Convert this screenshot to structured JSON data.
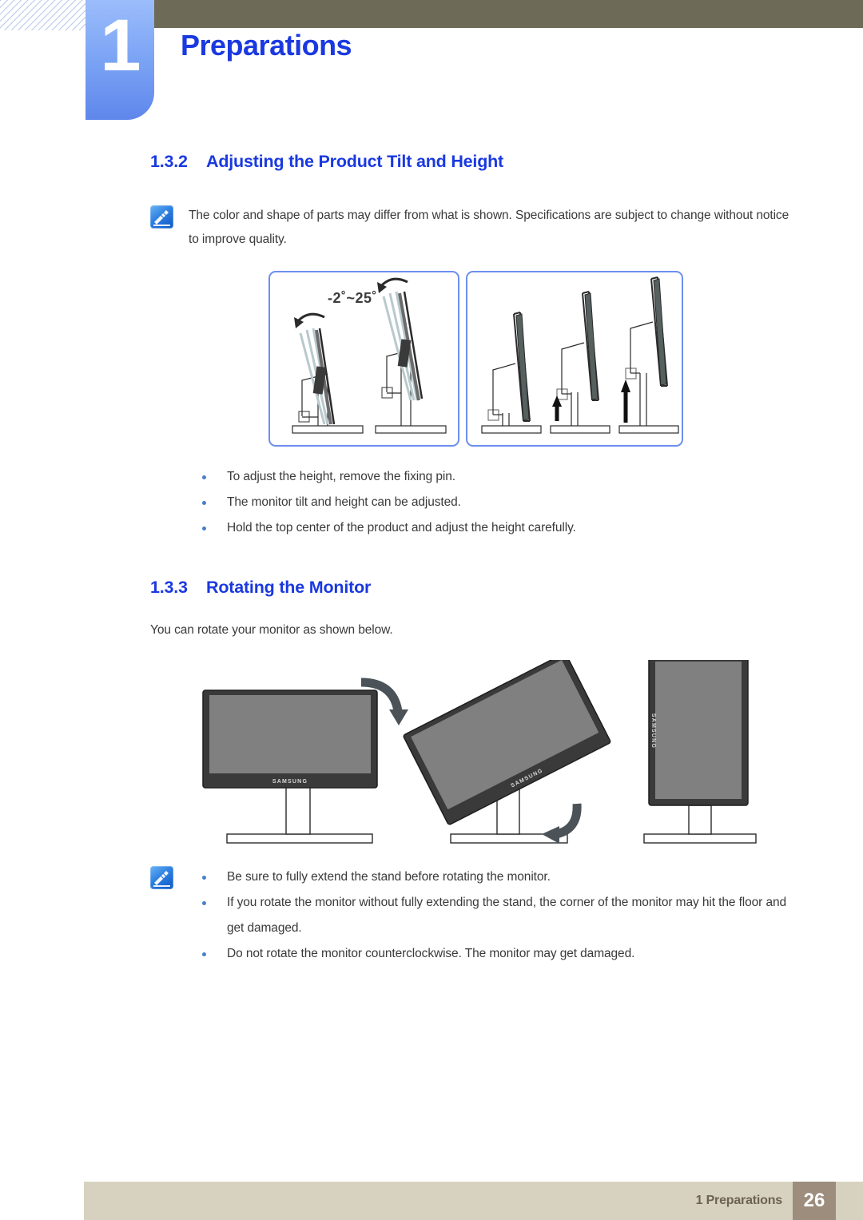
{
  "header": {
    "chapter_number": "1",
    "chapter_title": "Preparations",
    "tab_color": "#7ea6f5",
    "bar_color": "#6d6b57",
    "title_color": "#1a39e0"
  },
  "sections": [
    {
      "number": "1.3.2",
      "title": "Adjusting the Product Tilt and Height",
      "note": "The color and shape of parts may differ from what is shown. Specifications are subject to change without notice to improve quality.",
      "figure": {
        "tilt_label": "-2˚~25˚",
        "panel_border_color": "#6d8ef0",
        "left_panel_name": "tilt-range-diagram",
        "right_panel_name": "height-range-diagram"
      },
      "bullets": [
        "To adjust the height, remove the fixing pin.",
        "The monitor tilt and height can be adjusted.",
        "Hold the top center of the product and adjust the height carefully."
      ]
    },
    {
      "number": "1.3.3",
      "title": "Rotating the Monitor",
      "intro": "You can rotate your monitor as shown below.",
      "figure": {
        "brand_label": "SAMSUNG",
        "screen_color": "#808080",
        "bezel_color": "#3a3a3a"
      },
      "bullets": [
        "Be sure to fully extend the stand before rotating the monitor.",
        "If you rotate the monitor without fully extending the stand, the corner of the monitor may hit the floor and get damaged.",
        "Do not rotate the monitor counterclockwise. The monitor may get damaged."
      ]
    }
  ],
  "footer": {
    "label": "1 Preparations",
    "page_number": "26",
    "bar_color": "#d6d2bf",
    "page_box_color": "#9c8d7d"
  }
}
